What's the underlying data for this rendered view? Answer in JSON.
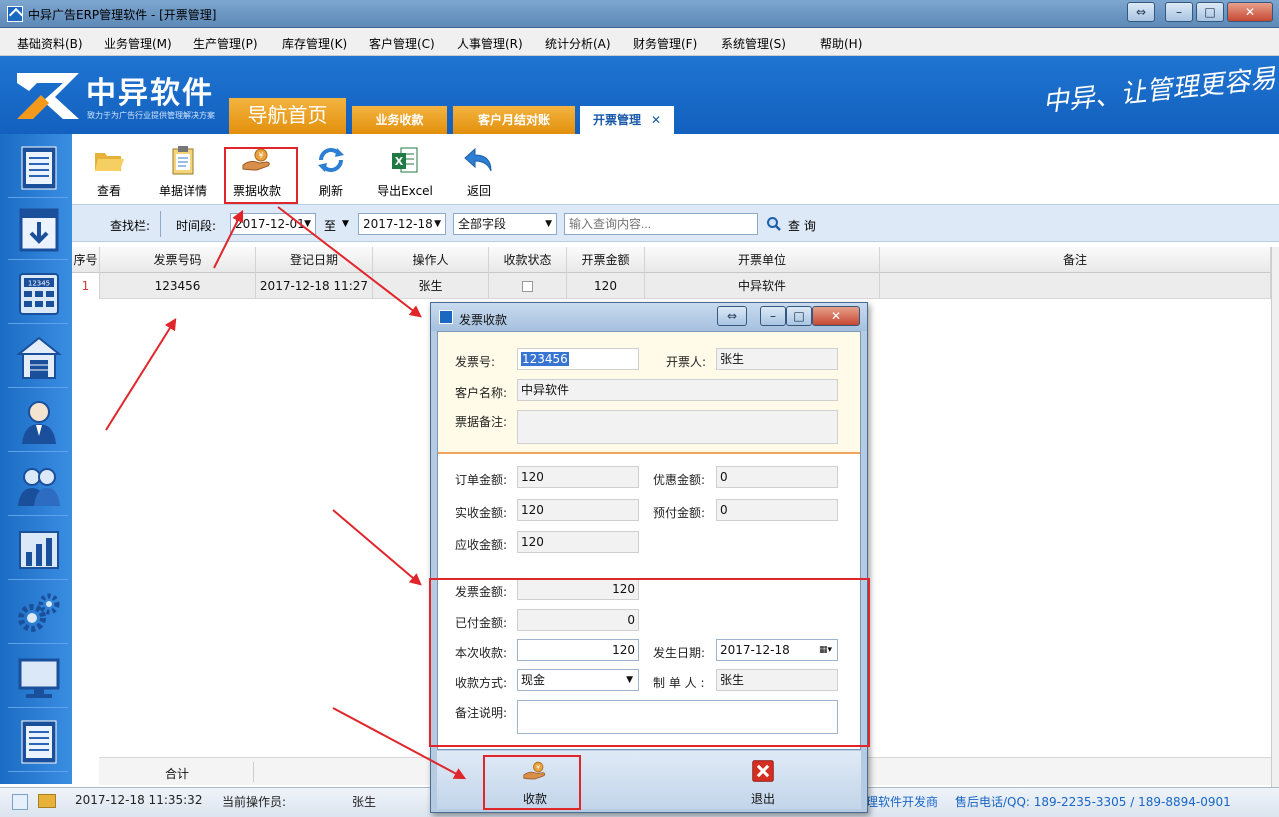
{
  "window": {
    "title": "中异广告ERP管理软件 - [开票管理]",
    "buttons": [
      "⇔",
      "–",
      "□",
      "✕"
    ]
  },
  "menu": [
    "基础资料(B)",
    "业务管理(M)",
    "生产管理(P)",
    "库存管理(K)",
    "客户管理(C)",
    "人事管理(R)",
    "统计分析(A)",
    "财务管理(F)",
    "系统管理(S)",
    "帮助(H)"
  ],
  "banner": {
    "brand": "中异软件",
    "slogan": "致力于为广告行业提供管理解决方案",
    "motto": "中异、让管理更容易"
  },
  "tabs": [
    {
      "label": "导航首页"
    },
    {
      "label": "业务收款"
    },
    {
      "label": "客户月结对账"
    },
    {
      "label": "开票管理",
      "close": "✕"
    }
  ],
  "toolbar": [
    {
      "label": "查看",
      "icon": "folder-open-icon"
    },
    {
      "label": "单据详情",
      "icon": "clipboard-icon"
    },
    {
      "label": "票据收款",
      "icon": "hand-coin-icon"
    },
    {
      "label": "刷新",
      "icon": "refresh-icon"
    },
    {
      "label": "导出Excel",
      "icon": "excel-icon"
    },
    {
      "label": "返回",
      "icon": "back-arrow-icon"
    }
  ],
  "search": {
    "label": "查找栏:",
    "period_label": "时间段:",
    "date_from": "2017-12-01",
    "to_label": "至",
    "date_to": "2017-12-18",
    "field": "全部字段",
    "placeholder": "输入查询内容...",
    "button": "查 询"
  },
  "grid": {
    "columns": [
      "序号",
      "发票号码",
      "登记日期",
      "操作人",
      "收款状态",
      "开票金额",
      "开票单位",
      "备注"
    ],
    "rows": [
      {
        "index": "1",
        "invoice_no": "123456",
        "date": "2017-12-18 11:27",
        "operator": "张生",
        "paid": false,
        "amount": "120",
        "unit": "中异软件",
        "note": ""
      }
    ],
    "footer_label": "合计"
  },
  "dialog": {
    "title": "发票收款",
    "title_buttons": [
      "⇔",
      "–",
      "□",
      "✕"
    ],
    "invoice_no_label": "发票号:",
    "invoice_no": "123456",
    "issuer_label": "开票人:",
    "issuer": "张生",
    "customer_label": "客户名称:",
    "customer": "中异软件",
    "remark_label": "票据备注:",
    "remark": "",
    "order_amount_label": "订单金额:",
    "order_amount": "120",
    "discount_label": "优惠金额:",
    "discount": "0",
    "received_label": "实收金额:",
    "received": "120",
    "prepaid_label": "预付金额:",
    "prepaid": "0",
    "receivable_label": "应收金额:",
    "receivable": "120",
    "invoice_amount_label": "发票金额:",
    "invoice_amount": "120",
    "paid_label": "已付金额:",
    "paid": "0",
    "this_payment_label": "本次收款:",
    "this_payment": "120",
    "date_label": "发生日期:",
    "date": "2017-12-18",
    "method_label": "收款方式:",
    "method": "现金",
    "maker_label": "制 单 人 :",
    "maker": "张生",
    "note_label": "备注说明:",
    "note": "",
    "collect_button": "收款",
    "exit_button": "退出"
  },
  "status": {
    "datetime": "2017-12-18 11:35:32",
    "operator_label": "当前操作员:",
    "operator": "张生",
    "right_text": "理软件开发商",
    "hotline": "售后电话/QQ:  189-2235-3305  / 189-8894-0901"
  },
  "colors": {
    "accent": "#1360bf",
    "tab": "#e8960f",
    "annotation": "#e0262b"
  }
}
